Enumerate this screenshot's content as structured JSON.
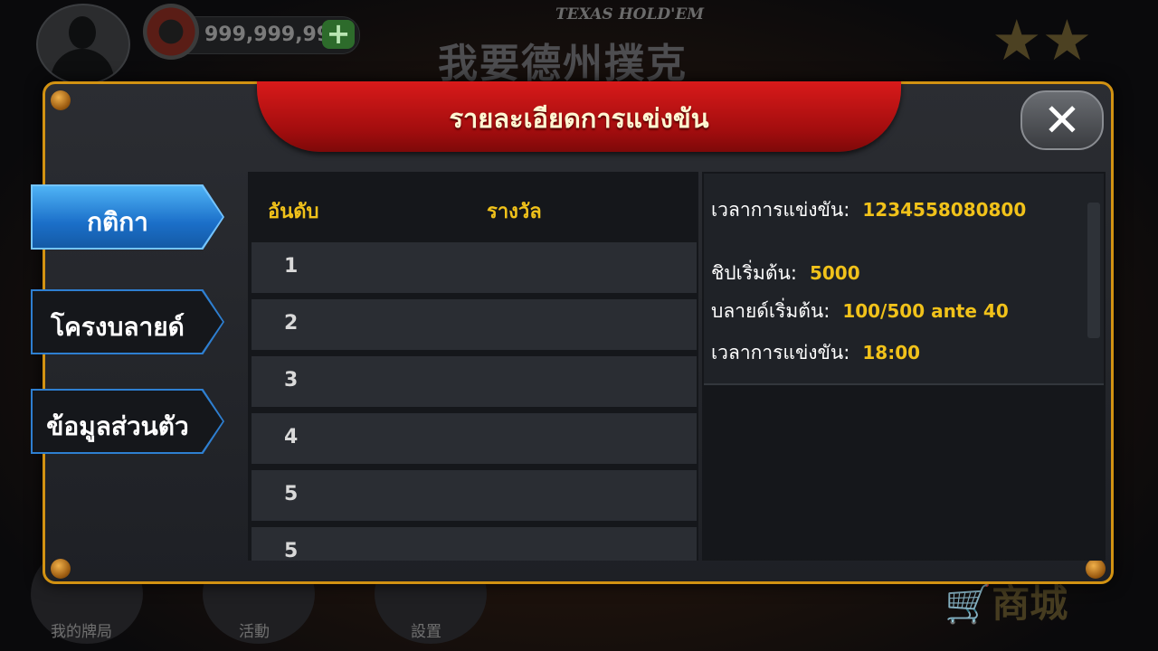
{
  "background": {
    "coins": "999,999,99",
    "logo_subtitle": "TEXAS HOLD'EM",
    "logo_text": "我要德州撲克",
    "bottom_nav": [
      "我的牌局",
      "活動",
      "設置"
    ],
    "shop_label": "商城"
  },
  "dialog": {
    "title": "รายละเอียดการแข่งขัน",
    "close_icon": "✕",
    "tabs": [
      {
        "label": "กติกา",
        "active": true
      },
      {
        "label": "โครงบลายด์",
        "active": false
      },
      {
        "label": "ข้อมูลส่วนตัว",
        "active": false
      }
    ],
    "table": {
      "headers": {
        "rank": "อันดับ",
        "prize": "รางวัล"
      },
      "rows": [
        "1",
        "2",
        "3",
        "4",
        "5",
        "5"
      ]
    },
    "info": [
      {
        "label": "เวลาการแข่งขัน:",
        "value": "1234558080800"
      },
      {
        "label": "ชิปเริ่มต้น:",
        "value": "5000"
      },
      {
        "label": "บลายด์เริ่มต้น:",
        "value": "100/500  ante 40"
      },
      {
        "label": "เวลาการแข่งขัน:",
        "value": "18:00"
      }
    ]
  },
  "colors": {
    "accent_gold": "#f1c21a",
    "banner_red": "#c21213",
    "border_orange": "#d29212",
    "tab_blue": "#2e7fd1"
  }
}
